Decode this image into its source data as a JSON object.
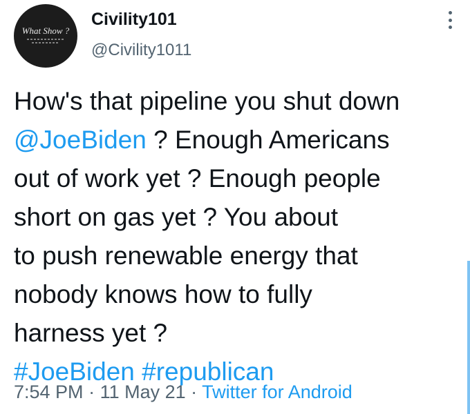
{
  "author": {
    "display_name": "Civility101",
    "handle": "@Civility1011",
    "avatar_text": "What Show ?"
  },
  "tweet": {
    "lines": [
      [
        {
          "text": "How's that pipeline you shut down",
          "type": "text"
        }
      ],
      [
        {
          "text": "@JoeBiden",
          "type": "mention"
        },
        {
          "text": " ? Enough Americans",
          "type": "text"
        }
      ],
      [
        {
          "text": "out of work yet ? Enough people",
          "type": "text"
        }
      ],
      [
        {
          "text": "short on gas yet ? You about",
          "type": "text"
        }
      ],
      [
        {
          "text": "to push renewable energy that",
          "type": "text"
        }
      ],
      [
        {
          "text": "nobody knows how to fully",
          "type": "text"
        }
      ],
      [
        {
          "text": "harness yet ?",
          "type": "text"
        }
      ],
      [
        {
          "text": "#JoeBiden",
          "type": "hashtag"
        },
        {
          "text": " ",
          "type": "text"
        },
        {
          "text": "#republican",
          "type": "hashtag"
        }
      ]
    ]
  },
  "meta": {
    "time": "7:54 PM",
    "separator": " · ",
    "date": "11 May 21",
    "source": "Twitter for Android"
  },
  "icons": {
    "more": "more-vertical-icon"
  },
  "colors": {
    "text": "#0f1419",
    "secondary": "#536471",
    "link": "#1d9bf0"
  }
}
